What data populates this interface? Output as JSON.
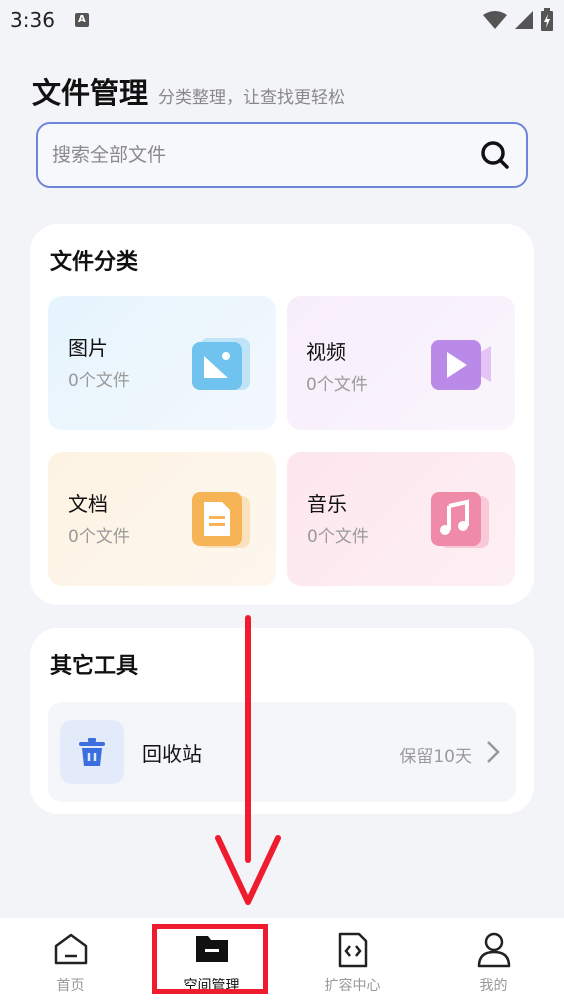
{
  "status": {
    "time": "3:36",
    "notification_icon": "A"
  },
  "header": {
    "title": "文件管理",
    "subtitle": "分类整理，让查找更轻松"
  },
  "search": {
    "placeholder": "搜索全部文件"
  },
  "categories": {
    "title": "文件分类",
    "items": [
      {
        "name": "图片",
        "count": "0个文件",
        "icon": "image-icon"
      },
      {
        "name": "视频",
        "count": "0个文件",
        "icon": "video-icon"
      },
      {
        "name": "文档",
        "count": "0个文件",
        "icon": "document-icon"
      },
      {
        "name": "音乐",
        "count": "0个文件",
        "icon": "music-icon"
      }
    ]
  },
  "tools": {
    "title": "其它工具",
    "recycle": {
      "label": "回收站",
      "meta": "保留10天",
      "icon": "trash-icon"
    }
  },
  "nav": {
    "items": [
      {
        "label": "首页",
        "icon": "home-icon"
      },
      {
        "label": "空间管理",
        "icon": "folder-icon"
      },
      {
        "label": "扩容中心",
        "icon": "code-file-icon"
      },
      {
        "label": "我的",
        "icon": "user-icon"
      }
    ],
    "active_index": 1
  },
  "colors": {
    "accent_border": "#6f86d8",
    "annotation": "#ee1c2e"
  }
}
